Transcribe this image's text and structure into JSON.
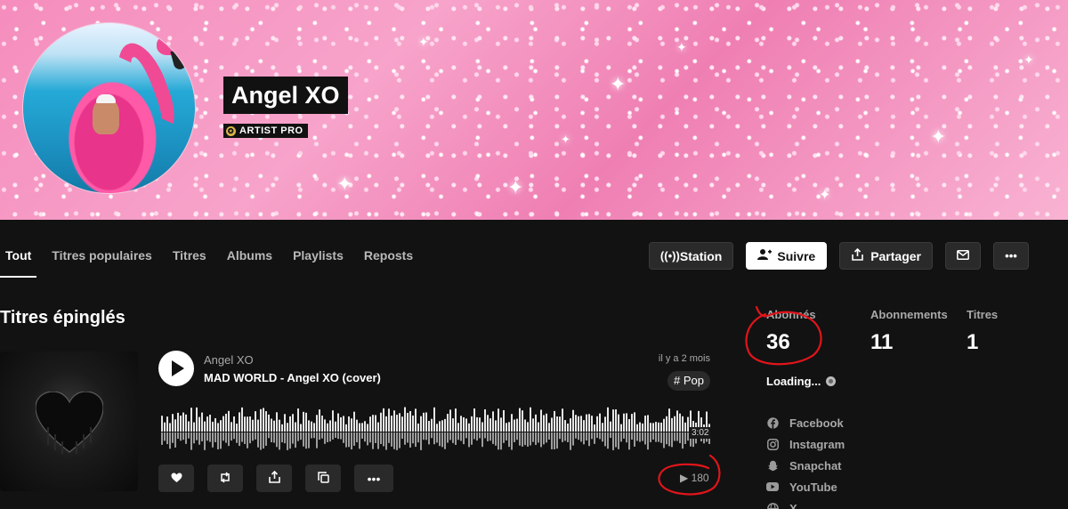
{
  "artist": {
    "name": "Angel XO",
    "badge": "ARTIST PRO"
  },
  "tabs": [
    "Tout",
    "Titres populaires",
    "Titres",
    "Albums",
    "Playlists",
    "Reposts"
  ],
  "actions": {
    "station": "Station",
    "follow": "Suivre",
    "share": "Partager"
  },
  "pinned": {
    "section_title": "Titres épinglés",
    "track": {
      "artist": "Angel XO",
      "title": "MAD WORLD - Angel XO (cover)",
      "posted": "il y a 2 mois",
      "tag": "# Pop",
      "duration": "3:02",
      "plays": "180"
    }
  },
  "stats": [
    {
      "label": "Abonnés",
      "value": "36"
    },
    {
      "label": "Abonnements",
      "value": "11"
    },
    {
      "label": "Titres",
      "value": "1"
    }
  ],
  "loading_text": "Loading...",
  "socials": [
    {
      "name": "Facebook",
      "icon": "facebook-icon"
    },
    {
      "name": "Instagram",
      "icon": "instagram-icon"
    },
    {
      "name": "Snapchat",
      "icon": "snapchat-icon"
    },
    {
      "name": "YouTube",
      "icon": "youtube-icon"
    },
    {
      "name": "X",
      "icon": "x-icon"
    }
  ],
  "colors": {
    "background": "#121212",
    "banner_pink": "#f7a3ca",
    "annotation_red": "#e0151b"
  }
}
